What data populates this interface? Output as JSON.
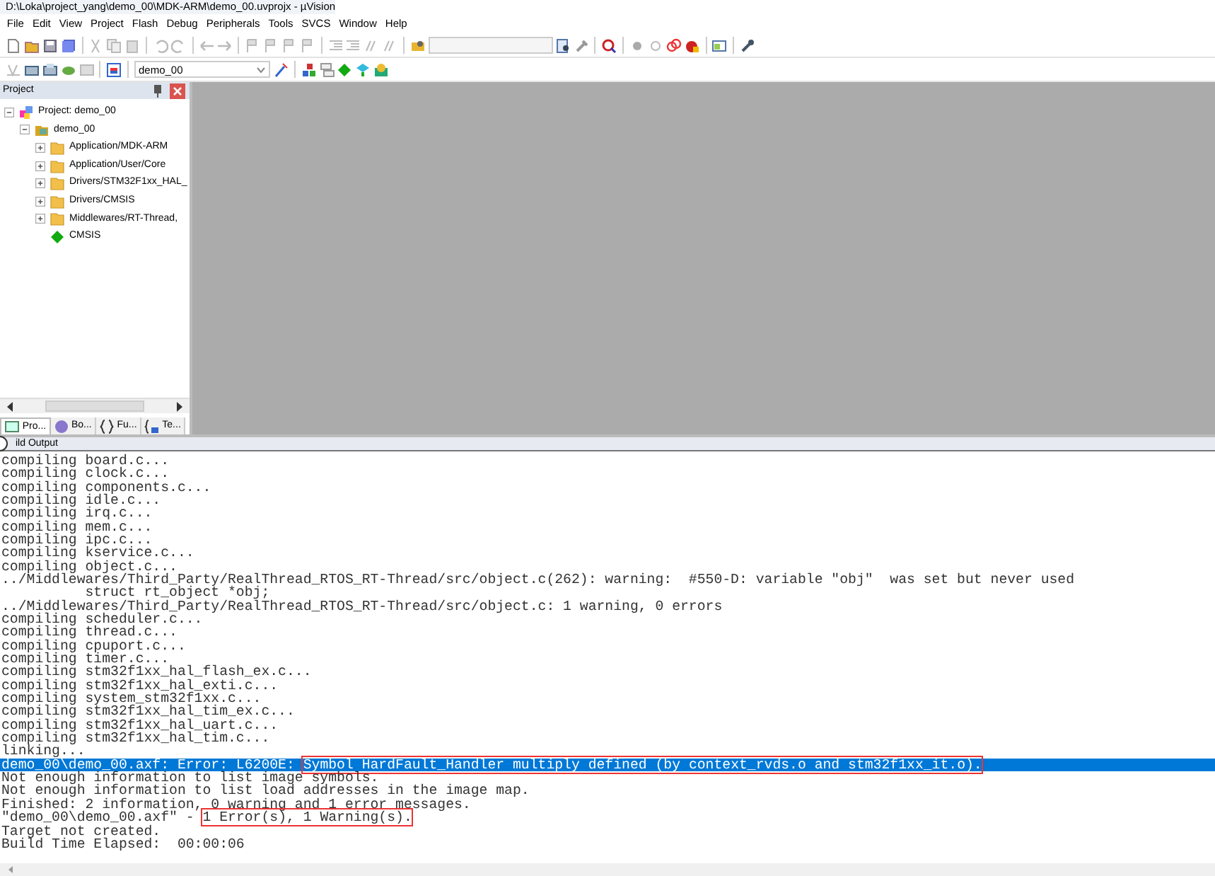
{
  "window": {
    "title": "D:\\Loka\\project_yang\\demo_00\\MDK-ARM\\demo_00.uvprojx - µVision"
  },
  "menu": [
    "File",
    "Edit",
    "View",
    "Project",
    "Flash",
    "Debug",
    "Peripherals",
    "Tools",
    "SVCS",
    "Window",
    "Help"
  ],
  "toolbar": {
    "target": "demo_00"
  },
  "project_panel": {
    "title": "Project",
    "tree": [
      {
        "label": "Project: demo_00",
        "kind": "project",
        "expanded": true,
        "children": [
          {
            "label": "demo_00",
            "kind": "target",
            "expanded": true,
            "children": [
              {
                "label": "Application/MDK-ARM",
                "kind": "folder",
                "expanded": false
              },
              {
                "label": "Application/User/Core",
                "kind": "folder",
                "expanded": false
              },
              {
                "label": "Drivers/STM32F1xx_HAL_",
                "kind": "folder",
                "expanded": false
              },
              {
                "label": "Drivers/CMSIS",
                "kind": "folder",
                "expanded": false
              },
              {
                "label": "Middlewares/RT-Thread,",
                "kind": "folder",
                "expanded": false
              },
              {
                "label": "CMSIS",
                "kind": "component"
              }
            ]
          }
        ]
      }
    ],
    "tabs": [
      {
        "label": "Pro...",
        "selected": true
      },
      {
        "label": "Bo...",
        "selected": false
      },
      {
        "label": "Fu...",
        "selected": false
      },
      {
        "label": "Te...",
        "selected": false
      }
    ]
  },
  "build_output": {
    "title": "ild Output",
    "lines": [
      {
        "kind": "plain",
        "text": "compiling board.c...",
        "selected": false
      },
      {
        "kind": "plain",
        "text": "compiling clock.c...",
        "selected": false
      },
      {
        "kind": "plain",
        "text": "compiling components.c...",
        "selected": false
      },
      {
        "kind": "plain",
        "text": "compiling idle.c...",
        "selected": false
      },
      {
        "kind": "plain",
        "text": "compiling irq.c...",
        "selected": false
      },
      {
        "kind": "plain",
        "text": "compiling mem.c...",
        "selected": false
      },
      {
        "kind": "plain",
        "text": "compiling ipc.c...",
        "selected": false
      },
      {
        "kind": "plain",
        "text": "compiling kservice.c...",
        "selected": false
      },
      {
        "kind": "plain",
        "text": "compiling object.c...",
        "selected": false
      },
      {
        "kind": "plain",
        "text": "../Middlewares/Third_Party/RealThread_RTOS_RT-Thread/src/object.c(262): warning:  #550-D: variable \"obj\"  was set but never used",
        "selected": false
      },
      {
        "kind": "plain",
        "text": "          struct rt_object *obj;",
        "selected": false
      },
      {
        "kind": "plain",
        "text": "../Middlewares/Third_Party/RealThread_RTOS_RT-Thread/src/object.c: 1 warning, 0 errors",
        "selected": false
      },
      {
        "kind": "plain",
        "text": "compiling scheduler.c...",
        "selected": false
      },
      {
        "kind": "plain",
        "text": "compiling thread.c...",
        "selected": false
      },
      {
        "kind": "plain",
        "text": "compiling cpuport.c...",
        "selected": false
      },
      {
        "kind": "plain",
        "text": "compiling timer.c...",
        "selected": false
      },
      {
        "kind": "plain",
        "text": "compiling stm32f1xx_hal_flash_ex.c...",
        "selected": false
      },
      {
        "kind": "plain",
        "text": "compiling stm32f1xx_hal_exti.c...",
        "selected": false
      },
      {
        "kind": "plain",
        "text": "compiling system_stm32f1xx.c...",
        "selected": false
      },
      {
        "kind": "plain",
        "text": "compiling stm32f1xx_hal_tim_ex.c...",
        "selected": false
      },
      {
        "kind": "plain",
        "text": "compiling stm32f1xx_hal_uart.c...",
        "selected": false
      },
      {
        "kind": "plain",
        "text": "compiling stm32f1xx_hal_tim.c...",
        "selected": false
      },
      {
        "kind": "plain",
        "text": "linking...",
        "selected": false
      },
      {
        "kind": "marked",
        "selected": true,
        "parts": [
          {
            "text": "demo_00\\demo_00.axf: Error: L6200E: ",
            "boxed": false
          },
          {
            "text": "Symbol HardFault_Handler multiply defined (by context_rvds.o and stm32f1xx_it.o).",
            "boxed": true
          }
        ]
      },
      {
        "kind": "plain",
        "text": "Not enough information to list image symbols.",
        "selected": false
      },
      {
        "kind": "plain",
        "text": "Not enough information to list load addresses in the image map.",
        "selected": false
      },
      {
        "kind": "plain",
        "text": "Finished: 2 information, 0 warning and 1 error messages.",
        "selected": false
      },
      {
        "kind": "marked",
        "selected": false,
        "parts": [
          {
            "text": "\"demo_00\\demo_00.axf\" - ",
            "boxed": false
          },
          {
            "text": "1 Error(s), 1 Warning(s).",
            "boxed": true
          }
        ]
      },
      {
        "kind": "plain",
        "text": "Target not created.",
        "selected": false
      },
      {
        "kind": "plain",
        "text": "Build Time Elapsed:  00:00:06",
        "selected": false
      }
    ]
  }
}
